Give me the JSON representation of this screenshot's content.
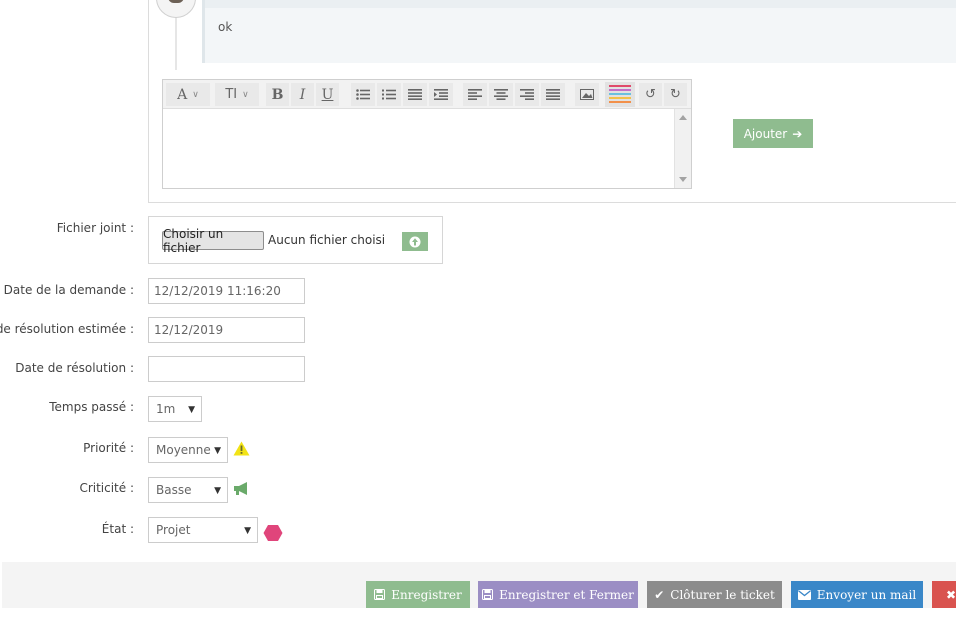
{
  "comment": {
    "text": "ok"
  },
  "editor": {
    "toolbar": {
      "font_glyph": "A",
      "size_glyph": "TI",
      "bold_glyph": "B",
      "italic_glyph": "I",
      "underline_glyph": "U"
    },
    "submit_label": "Ajouter"
  },
  "form": {
    "attachment": {
      "label": "Fichier joint :",
      "choose_label": "Choisir un fichier",
      "status": "Aucun fichier choisi"
    },
    "request_date": {
      "label": "Date de la demande :",
      "value": "12/12/2019 11:16:20"
    },
    "estimated_resolution_date": {
      "label": "de résolution estimée :",
      "value": "12/12/2019"
    },
    "resolution_date": {
      "label": "Date de résolution :",
      "value": ""
    },
    "time_spent": {
      "label": "Temps passé :",
      "value": "1m"
    },
    "priority": {
      "label": "Priorité :",
      "value": "Moyenne"
    },
    "criticity": {
      "label": "Criticité :",
      "value": "Basse"
    },
    "state": {
      "label": "État :",
      "value": "Projet"
    }
  },
  "footer": {
    "save_label": "Enregistrer",
    "save_close_label": "Enregistrer et Fermer",
    "close_ticket_label": "Clôturer le ticket",
    "send_mail_label": "Envoyer un mail"
  },
  "colors": {
    "green": "#8fbc8f",
    "purple": "#9b8ec4",
    "gray": "#8c8c8c",
    "blue": "#3a87c8",
    "red": "#d9534f",
    "warning_yellow": "#f2e316",
    "state_pink": "#e0457b"
  }
}
